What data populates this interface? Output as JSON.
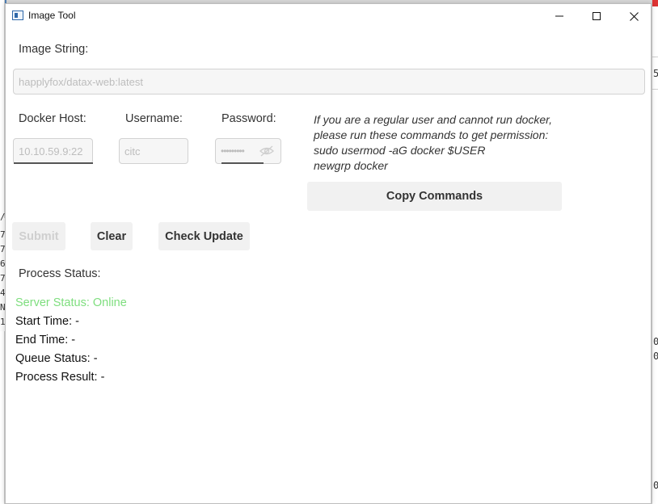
{
  "window": {
    "title": "Image Tool",
    "icon": "app-window-icon"
  },
  "form": {
    "image_string_label": "Image String:",
    "image_string_value": "happlyfox/datax-web:latest",
    "docker_host_label": "Docker Host:",
    "docker_host_value": "10.10.59.9:22",
    "username_label": "Username:",
    "username_value": "citc",
    "password_label": "Password:",
    "password_value": "•••••••••"
  },
  "hint": {
    "lines": [
      "If you are a regular user and cannot run docker,",
      "please run these commands to get permission:",
      "sudo usermod -aG docker $USER",
      "newgrp docker"
    ]
  },
  "buttons": {
    "copy_commands": "Copy Commands",
    "submit": "Submit",
    "clear": "Clear",
    "check_update": "Check Update"
  },
  "status": {
    "title": "Process Status:",
    "server_status": "Server Status: Online",
    "start_time": "Start Time: -",
    "end_time": "End Time: -",
    "queue_status": "Queue Status: -",
    "process_result": "Process Result: -",
    "online_color": "#7ede7e"
  }
}
